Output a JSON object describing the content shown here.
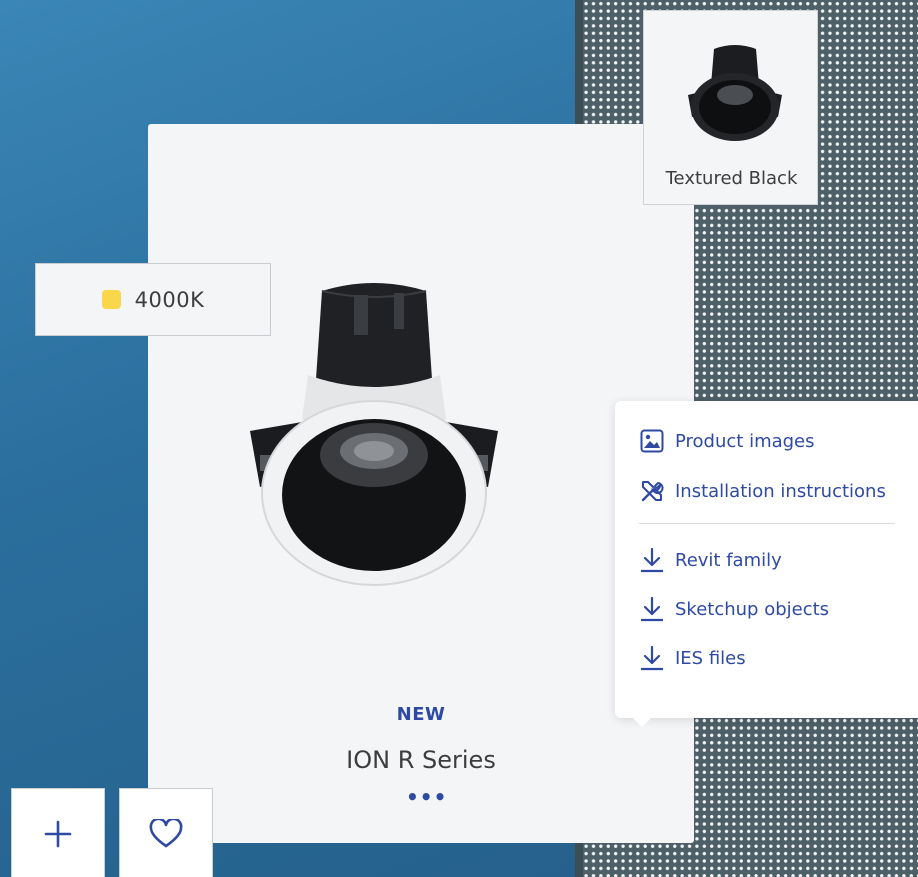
{
  "product": {
    "badge": "NEW",
    "title": "ION R Series",
    "more": "•••"
  },
  "finish": {
    "label": "Textured Black"
  },
  "color_temperature": {
    "label": "4000K",
    "swatch_color": "#f9d74a"
  },
  "menu": {
    "items": [
      {
        "label": "Product images",
        "icon": "image-icon"
      },
      {
        "label": "Installation instructions",
        "icon": "tools-icon"
      },
      {
        "label": "Revit family",
        "icon": "download-icon"
      },
      {
        "label": "Sketchup objects",
        "icon": "download-icon"
      },
      {
        "label": "IES files",
        "icon": "download-icon"
      }
    ]
  },
  "actions": [
    {
      "name": "add",
      "icon": "plus-icon"
    },
    {
      "name": "favorite",
      "icon": "heart-icon"
    }
  ],
  "colors": {
    "accent": "#2e4aa3",
    "card": "#f4f5f7"
  }
}
